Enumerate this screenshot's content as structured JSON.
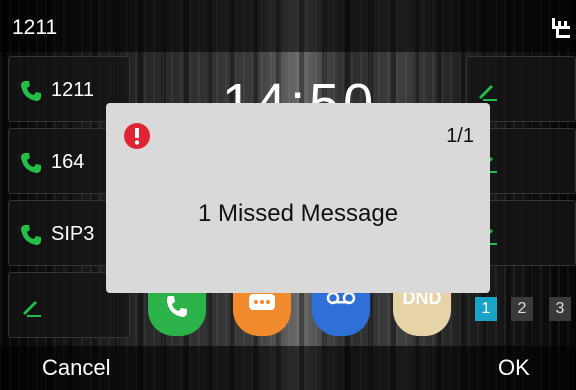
{
  "status_bar": {
    "title": "1211",
    "network_icon": "network-icon"
  },
  "line_keys": [
    {
      "label": "1211",
      "icon": "phone-handset-icon"
    },
    {
      "label": "164",
      "icon": "phone-handset-icon"
    },
    {
      "label": "SIP3",
      "icon": "phone-handset-icon"
    },
    {
      "label": "",
      "icon": "edit-pencil-icon"
    }
  ],
  "right_keys": [
    {
      "icon": "edit-pencil-icon"
    },
    {
      "icon": "edit-pencil-icon"
    },
    {
      "icon": "edit-pencil-icon"
    }
  ],
  "clock": {
    "time": "14:50"
  },
  "apps": [
    {
      "name": "phone",
      "glyph": "",
      "color": "#2bb34a"
    },
    {
      "name": "messages",
      "glyph": "···",
      "color": "#f08a2c"
    },
    {
      "name": "voicemail",
      "glyph": "",
      "color": "#2f6fd8"
    },
    {
      "name": "dnd",
      "glyph": "DND",
      "color": "#e7d3a8"
    }
  ],
  "pages": {
    "items": [
      "1",
      "2",
      "3"
    ],
    "active_index": 0
  },
  "dialog": {
    "counter": "1/1",
    "message": "1 Missed Message",
    "alert_icon": "alert-icon",
    "alert_color": "#e02433"
  },
  "softkeys": {
    "left": "Cancel",
    "right": "OK"
  },
  "colors": {
    "phone_green": "#1fbf4a",
    "dialog_background": "#d9d9d9",
    "page_active": "#1aa3c9"
  }
}
